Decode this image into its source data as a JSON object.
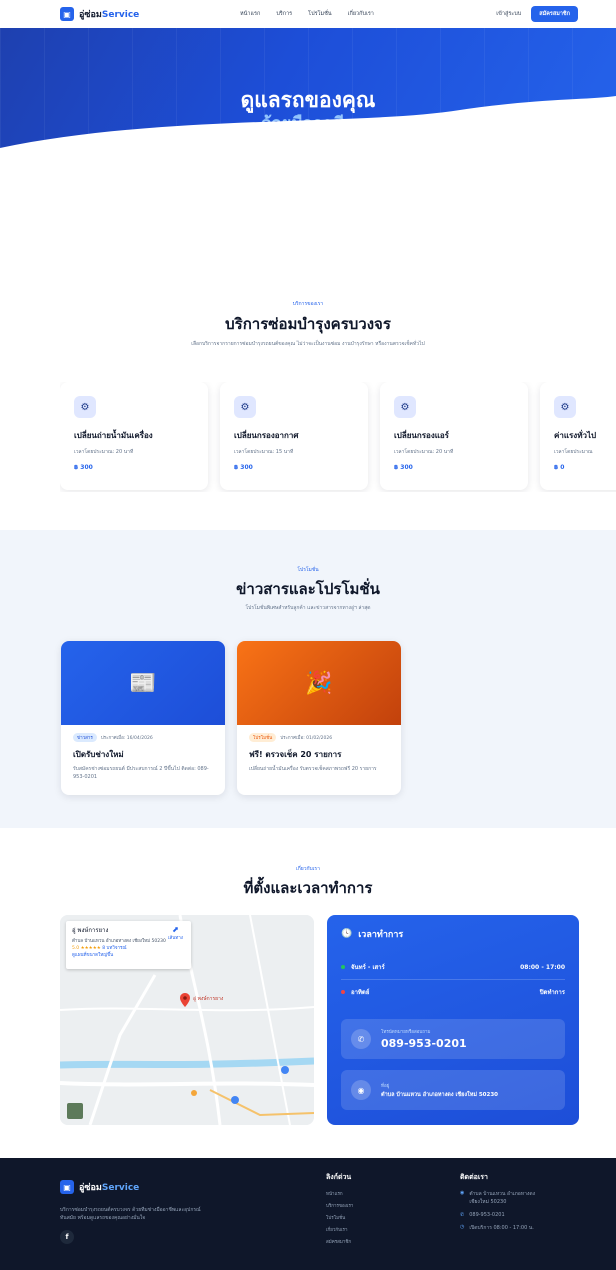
{
  "nav": {
    "brand_prefix": "อู่ซ่อม",
    "brand_suffix": "Service",
    "links": [
      "หน้าแรก",
      "บริการ",
      "โปรโมชั่น",
      "เกี่ยวกับเรา"
    ],
    "login": "เข้าสู่ระบบ",
    "signup": "สมัครสมาชิก"
  },
  "hero": {
    "title": "ดูแลรถของคุณ",
    "subtitle": "ด้วยมืออาชีพ"
  },
  "services": {
    "eyebrow": "บริการของเรา",
    "title": "บริการซ่อมบำรุงครบวงจร",
    "desc": "เลือกบริการจากรายการซ่อมบำรุงรถยนต์ของคุณ ไม่ว่าจะเป็นงานซ่อม งานบำรุงรักษา หรืองานตรวจเช็คทั่วไป",
    "items": [
      {
        "name": "เปลี่ยนถ่ายน้ำมันเครื่อง",
        "time": "เวลาโดยประมาณ: 20 นาที",
        "price": "฿ 300"
      },
      {
        "name": "เปลี่ยนกรองอากาศ",
        "time": "เวลาโดยประมาณ: 15 นาที",
        "price": "฿ 300"
      },
      {
        "name": "เปลี่ยนกรองแอร์",
        "time": "เวลาโดยประมาณ: 20 นาที",
        "price": "฿ 300"
      },
      {
        "name": "ค่าแรงทั่วไป",
        "time": "เวลาโดยประมาณ",
        "price": "฿ 0"
      }
    ]
  },
  "news": {
    "eyebrow": "โปรโมชั่น",
    "title": "ข่าวสารและโปรโมชั่น",
    "desc": "โปรโมชั่นพิเศษสำหรับลูกค้า และข่าวสารจากทางอู่ฯ ล่าสุด",
    "items": [
      {
        "tag": "ข่าวสาร",
        "date": "ประกาศเมื่อ: 16/04/2026",
        "title": "เปิดรับช่างใหม่",
        "text": "รับสมัครช่างซ่อมรถยนต์ มีประสบการณ์ 2 ปีขึ้นไป ติดต่อ: 089-953-0201"
      },
      {
        "tag": "โปรโมชั่น",
        "date": "ประกาศเมื่อ: 01/02/2026",
        "title": "ฟรี! ตรวจเช็ค 20 รายการ",
        "text": "เปลี่ยนถ่ายน้ำมันเครื่อง รับตรวจเช็คสภาพรถฟรี 20 รายการ"
      }
    ]
  },
  "location": {
    "eyebrow": "เกี่ยวกับเรา",
    "title": "ที่ตั้งและเวลาทำการ",
    "map": {
      "place": "อู่ พงษ์การยาง",
      "address": "ตำบล บ้านแหวน อำเภอหางดง เชียงใหม่ 50230",
      "rating": "5.0 ★★★★★",
      "reviews": "8 บทวิจารณ์",
      "bigger": "ดูแผนที่ขนาดใหญ่ขึ้น",
      "route": "เส้นทาง",
      "pin_label": "อู่ พงษ์การยาง"
    },
    "hours_title": "เวลาทำการ",
    "hours": [
      {
        "day": "จันทร์ - เสาร์",
        "time": "08:00 - 17:00",
        "dot": "#22c55e"
      },
      {
        "day": "อาทิตย์",
        "time": "ปิดทำการ",
        "dot": "#ef4444"
      }
    ],
    "phone_label": "โทรนัดหมายหรือสอบถาม",
    "phone": "089-953-0201",
    "addr_label": "ที่อยู่",
    "addr": "ตำบล บ้านแหวน อำเภอหางดง เชียงใหม่ 50230"
  },
  "footer": {
    "brand_prefix": "อู่ซ่อม",
    "brand_suffix": "Service",
    "about_1": "บริการซ่อมบำรุงรถยนต์ครบวงจร ด้วยทีมช่างมืออาชีพและอุปกรณ์",
    "about_2": "ทันสมัย พร้อมดูแลรถของคุณอย่างมั่นใจ",
    "quick_title": "ลิงก์ด่วน",
    "quick_links": [
      "หน้าแรก",
      "บริการของเรา",
      "โปรโมชั่น",
      "เกี่ยวกับเรา",
      "สมัครสมาชิก"
    ],
    "contact_title": "ติดต่อเรา",
    "contact_addr_1": "ตำบล บ้านแหวน อำเภอหางดง",
    "contact_addr_2": "เชียงใหม่ 50230",
    "contact_phone": "089-953-0201",
    "contact_hours": "เปิดบริการ 08:00 - 17:00 น."
  },
  "colors": {
    "primary": "#2563eb",
    "dark": "#0f172a",
    "tag_news_bg": "#dbeafe",
    "tag_news_fg": "#1d4ed8",
    "tag_promo_bg": "#ffedd5",
    "tag_promo_fg": "#ea580c"
  },
  "icons": {
    "logo": "garage-icon",
    "service": "gear-icon",
    "news_1": "newspaper-icon",
    "news_2": "party-popper-icon",
    "clock": "clock-icon",
    "phone": "phone-icon",
    "pin": "map-pin-icon",
    "facebook": "facebook-icon"
  }
}
